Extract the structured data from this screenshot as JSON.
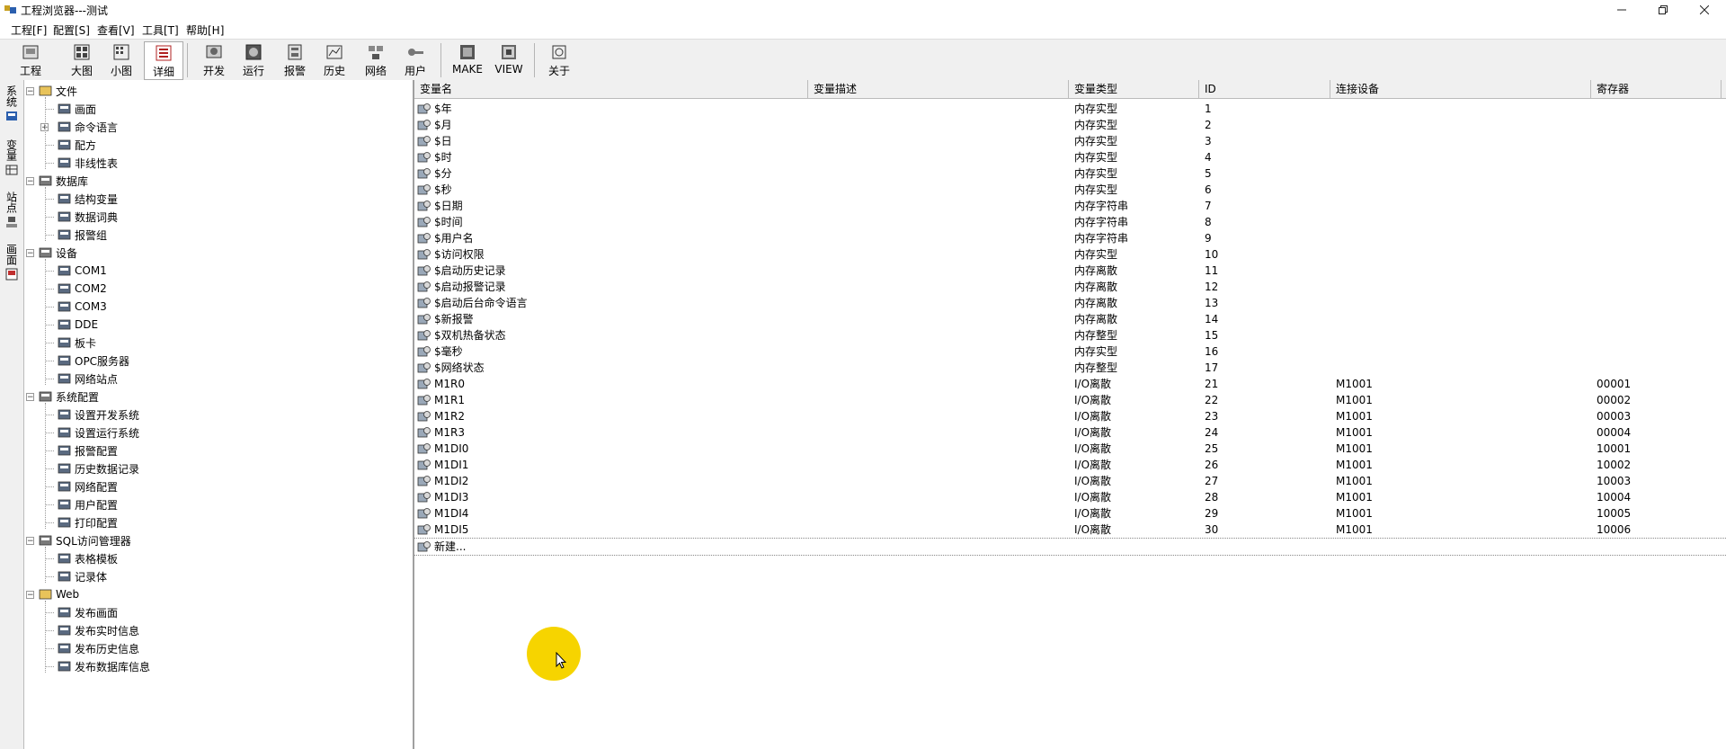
{
  "window": {
    "title": "工程浏览器---测试",
    "controls": [
      "minimize",
      "restore",
      "close"
    ]
  },
  "menu": [
    "工程[F]",
    "配置[S]",
    "查看[V]",
    "工具[T]",
    "帮助[H]"
  ],
  "toolbar": [
    {
      "label": "工程",
      "icon": "project-icon"
    },
    {
      "label": "大图",
      "icon": "large-icons-icon"
    },
    {
      "label": "小图",
      "icon": "small-icons-icon"
    },
    {
      "label": "详细",
      "icon": "details-icon",
      "active": true
    },
    {
      "label": "开发",
      "icon": "develop-icon"
    },
    {
      "label": "运行",
      "icon": "run-icon"
    },
    {
      "label": "报警",
      "icon": "alarm-icon"
    },
    {
      "label": "历史",
      "icon": "history-icon"
    },
    {
      "label": "网络",
      "icon": "network-icon"
    },
    {
      "label": "用户",
      "icon": "user-key-icon"
    },
    {
      "label": "MAKE",
      "icon": "make-icon"
    },
    {
      "label": "VIEW",
      "icon": "view-icon"
    },
    {
      "label": "关于",
      "icon": "about-icon"
    }
  ],
  "side_tabs": [
    "系统",
    "变量",
    "站点",
    "画面"
  ],
  "tree": [
    {
      "label": "文件",
      "level": 0,
      "expander": "-",
      "icon": "folder-icon"
    },
    {
      "label": "画面",
      "level": 1,
      "icon": "screen-icon"
    },
    {
      "label": "命令语言",
      "level": 1,
      "expander": "+",
      "icon": "script-icon"
    },
    {
      "label": "配方",
      "level": 1,
      "icon": "recipe-icon"
    },
    {
      "label": "非线性表",
      "level": 1,
      "icon": "table-icon"
    },
    {
      "label": "数据库",
      "level": 0,
      "expander": "-",
      "icon": "database-icon"
    },
    {
      "label": "结构变量",
      "level": 1,
      "icon": "struct-icon"
    },
    {
      "label": "数据词典",
      "level": 1,
      "icon": "dictionary-icon"
    },
    {
      "label": "报警组",
      "level": 1,
      "icon": "alarm-group-icon"
    },
    {
      "label": "设备",
      "level": 0,
      "expander": "-",
      "icon": "device-icon"
    },
    {
      "label": "COM1",
      "level": 1,
      "icon": "com-port-icon"
    },
    {
      "label": "COM2",
      "level": 1,
      "icon": "com-port-icon"
    },
    {
      "label": "COM3",
      "level": 1,
      "icon": "com-port-icon"
    },
    {
      "label": "DDE",
      "level": 1,
      "icon": "dde-icon"
    },
    {
      "label": "板卡",
      "level": 1,
      "icon": "board-icon"
    },
    {
      "label": "OPC服务器",
      "level": 1,
      "icon": "opc-icon"
    },
    {
      "label": "网络站点",
      "level": 1,
      "icon": "network-node-icon"
    },
    {
      "label": "系统配置",
      "level": 0,
      "expander": "-",
      "icon": "tools-icon"
    },
    {
      "label": "设置开发系统",
      "level": 1,
      "icon": "dev-setup-icon"
    },
    {
      "label": "设置运行系统",
      "level": 1,
      "icon": "run-setup-icon"
    },
    {
      "label": "报警配置",
      "level": 1,
      "icon": "alarm-config-icon"
    },
    {
      "label": "历史数据记录",
      "level": 1,
      "icon": "history-record-icon"
    },
    {
      "label": "网络配置",
      "level": 1,
      "icon": "network-config-icon"
    },
    {
      "label": "用户配置",
      "level": 1,
      "icon": "user-config-icon"
    },
    {
      "label": "打印配置",
      "level": 1,
      "icon": "printer-icon"
    },
    {
      "label": "SQL访问管理器",
      "level": 0,
      "expander": "-",
      "icon": "sql-icon"
    },
    {
      "label": "表格模板",
      "level": 1,
      "icon": "table-template-icon"
    },
    {
      "label": "记录体",
      "level": 1,
      "icon": "function-icon"
    },
    {
      "label": "Web",
      "level": 0,
      "expander": "-",
      "icon": "folder-icon"
    },
    {
      "label": "发布画面",
      "level": 1,
      "icon": "publish-screen-icon"
    },
    {
      "label": "发布实时信息",
      "level": 1,
      "icon": "function-icon"
    },
    {
      "label": "发布历史信息",
      "level": 1,
      "icon": "function-icon"
    },
    {
      "label": "发布数据库信息",
      "level": 1,
      "icon": "publish-db-icon"
    }
  ],
  "grid": {
    "columns": [
      "变量名",
      "变量描述",
      "变量类型",
      "ID",
      "连接设备",
      "寄存器"
    ],
    "rows": [
      {
        "name": "$年",
        "desc": "",
        "type": "内存实型",
        "id": "1",
        "device": "",
        "register": ""
      },
      {
        "name": "$月",
        "desc": "",
        "type": "内存实型",
        "id": "2",
        "device": "",
        "register": ""
      },
      {
        "name": "$日",
        "desc": "",
        "type": "内存实型",
        "id": "3",
        "device": "",
        "register": ""
      },
      {
        "name": "$时",
        "desc": "",
        "type": "内存实型",
        "id": "4",
        "device": "",
        "register": ""
      },
      {
        "name": "$分",
        "desc": "",
        "type": "内存实型",
        "id": "5",
        "device": "",
        "register": ""
      },
      {
        "name": "$秒",
        "desc": "",
        "type": "内存实型",
        "id": "6",
        "device": "",
        "register": ""
      },
      {
        "name": "$日期",
        "desc": "",
        "type": "内存字符串",
        "id": "7",
        "device": "",
        "register": ""
      },
      {
        "name": "$时间",
        "desc": "",
        "type": "内存字符串",
        "id": "8",
        "device": "",
        "register": ""
      },
      {
        "name": "$用户名",
        "desc": "",
        "type": "内存字符串",
        "id": "9",
        "device": "",
        "register": ""
      },
      {
        "name": "$访问权限",
        "desc": "",
        "type": "内存实型",
        "id": "10",
        "device": "",
        "register": ""
      },
      {
        "name": "$启动历史记录",
        "desc": "",
        "type": "内存离散",
        "id": "11",
        "device": "",
        "register": ""
      },
      {
        "name": "$启动报警记录",
        "desc": "",
        "type": "内存离散",
        "id": "12",
        "device": "",
        "register": ""
      },
      {
        "name": "$启动后台命令语言",
        "desc": "",
        "type": "内存离散",
        "id": "13",
        "device": "",
        "register": ""
      },
      {
        "name": "$新报警",
        "desc": "",
        "type": "内存离散",
        "id": "14",
        "device": "",
        "register": ""
      },
      {
        "name": "$双机热备状态",
        "desc": "",
        "type": "内存整型",
        "id": "15",
        "device": "",
        "register": ""
      },
      {
        "name": "$毫秒",
        "desc": "",
        "type": "内存实型",
        "id": "16",
        "device": "",
        "register": ""
      },
      {
        "name": "$网络状态",
        "desc": "",
        "type": "内存整型",
        "id": "17",
        "device": "",
        "register": ""
      },
      {
        "name": "M1R0",
        "desc": "",
        "type": "I/O离散",
        "id": "21",
        "device": "M1001",
        "register": "00001"
      },
      {
        "name": "M1R1",
        "desc": "",
        "type": "I/O离散",
        "id": "22",
        "device": "M1001",
        "register": "00002"
      },
      {
        "name": "M1R2",
        "desc": "",
        "type": "I/O离散",
        "id": "23",
        "device": "M1001",
        "register": "00003"
      },
      {
        "name": "M1R3",
        "desc": "",
        "type": "I/O离散",
        "id": "24",
        "device": "M1001",
        "register": "00004"
      },
      {
        "name": "M1DI0",
        "desc": "",
        "type": "I/O离散",
        "id": "25",
        "device": "M1001",
        "register": "10001"
      },
      {
        "name": "M1DI1",
        "desc": "",
        "type": "I/O离散",
        "id": "26",
        "device": "M1001",
        "register": "10002"
      },
      {
        "name": "M1DI2",
        "desc": "",
        "type": "I/O离散",
        "id": "27",
        "device": "M1001",
        "register": "10003"
      },
      {
        "name": "M1DI3",
        "desc": "",
        "type": "I/O离散",
        "id": "28",
        "device": "M1001",
        "register": "10004"
      },
      {
        "name": "M1DI4",
        "desc": "",
        "type": "I/O离散",
        "id": "29",
        "device": "M1001",
        "register": "10005"
      },
      {
        "name": "M1DI5",
        "desc": "",
        "type": "I/O离散",
        "id": "30",
        "device": "M1001",
        "register": "10006"
      }
    ],
    "new_row_label": "新建..."
  },
  "colors": {
    "toolbar_bg": "#f0f0f0",
    "cursor_highlight": "#f6d400"
  }
}
